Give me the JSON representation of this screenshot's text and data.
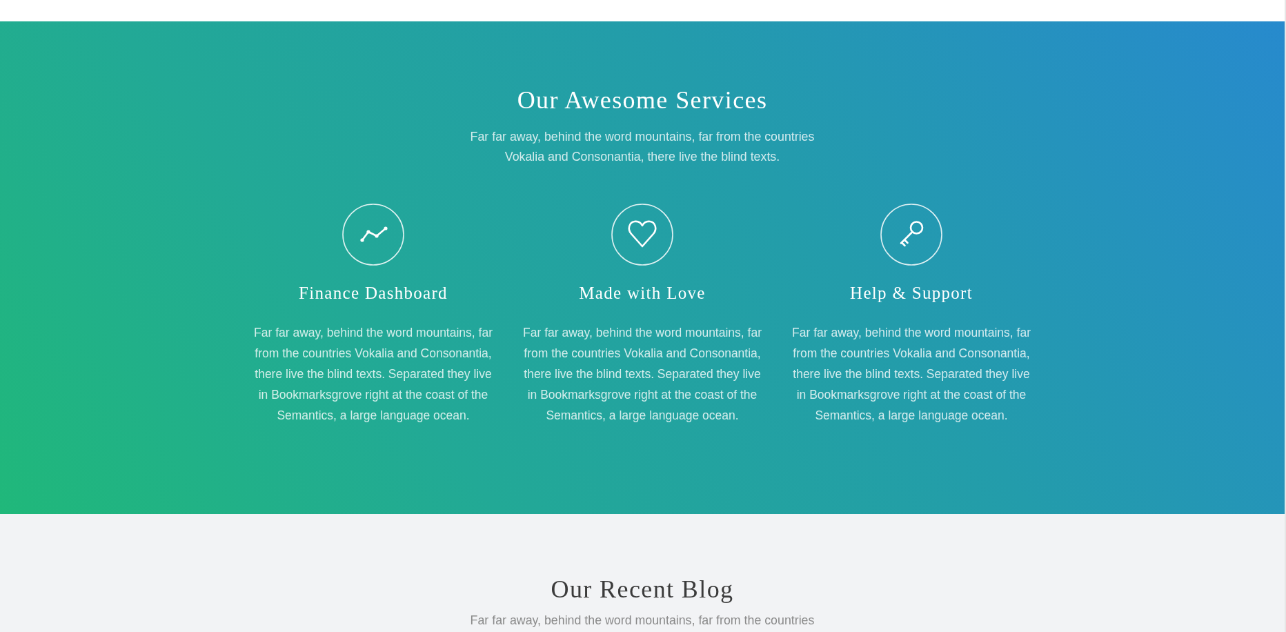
{
  "services_section": {
    "title": "Our Awesome Services",
    "subtitle": "Far far away, behind the word mountains, far from the countries Vokalia and Consonantia, there live the blind texts.",
    "services": [
      {
        "title": "Finance Dashboard",
        "description": "Far far away, behind the word mountains, far from the countries Vokalia and Consonantia, there live the blind texts. Separated they live in Bookmarksgrove right at the coast of the Semantics, a large language ocean."
      },
      {
        "title": "Made with Love",
        "description": "Far far away, behind the word mountains, far from the countries Vokalia and Consonantia, there live the blind texts. Separated they live in Bookmarksgrove right at the coast of the Semantics, a large language ocean."
      },
      {
        "title": "Help & Support",
        "description": "Far far away, behind the word mountains, far from the countries Vokalia and Consonantia, there live the blind texts. Separated they live in Bookmarksgrove right at the coast of the Semantics, a large language ocean."
      }
    ]
  },
  "blog_section": {
    "title": "Our Recent Blog",
    "subtitle": "Far far away, behind the word mountains, far from the countries"
  }
}
